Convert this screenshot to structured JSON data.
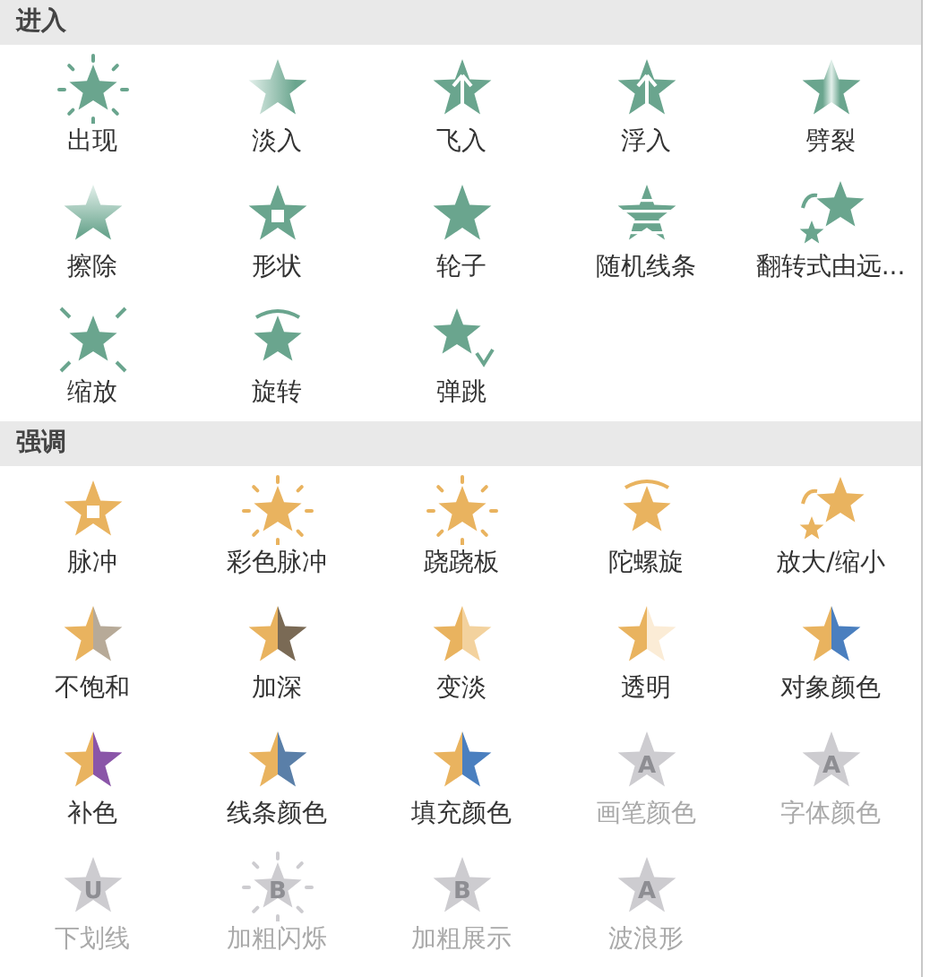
{
  "sections": [
    {
      "title": "进入",
      "kind": "entrance",
      "items": [
        {
          "label": "出现",
          "kind": "burst",
          "disabled": false
        },
        {
          "label": "淡入",
          "kind": "fadeleft",
          "disabled": false
        },
        {
          "label": "飞入",
          "kind": "arrow",
          "disabled": false
        },
        {
          "label": "浮入",
          "kind": "arrow",
          "disabled": false
        },
        {
          "label": "劈裂",
          "kind": "split",
          "disabled": false
        },
        {
          "label": "擦除",
          "kind": "fadetop",
          "disabled": false
        },
        {
          "label": "形状",
          "kind": "square",
          "disabled": false
        },
        {
          "label": "轮子",
          "kind": "plain",
          "disabled": false
        },
        {
          "label": "随机线条",
          "kind": "lines",
          "disabled": false
        },
        {
          "label": "翻转式由远...",
          "kind": "flip",
          "disabled": false
        },
        {
          "label": "缩放",
          "kind": "zoom",
          "disabled": false
        },
        {
          "label": "旋转",
          "kind": "spin",
          "disabled": false
        },
        {
          "label": "弹跳",
          "kind": "bounce",
          "disabled": false
        }
      ]
    },
    {
      "title": "强调",
      "kind": "emphasis",
      "items": [
        {
          "label": "脉冲",
          "kind": "glow",
          "disabled": false
        },
        {
          "label": "彩色脉冲",
          "kind": "burst",
          "disabled": false
        },
        {
          "label": "跷跷板",
          "kind": "burst",
          "disabled": false
        },
        {
          "label": "陀螺旋",
          "kind": "spin",
          "disabled": false
        },
        {
          "label": "放大/缩小",
          "kind": "flip",
          "disabled": false
        },
        {
          "label": "不饱和",
          "kind": "half",
          "color": "#b7aa98",
          "disabled": false
        },
        {
          "label": "加深",
          "kind": "half",
          "color": "#7a6a55",
          "disabled": false
        },
        {
          "label": "变淡",
          "kind": "half",
          "color": "#f3d29e",
          "disabled": false
        },
        {
          "label": "透明",
          "kind": "half",
          "color": "#fbecd6",
          "disabled": false
        },
        {
          "label": "对象颜色",
          "kind": "half",
          "color": "#4a7fbf",
          "disabled": false
        },
        {
          "label": "补色",
          "kind": "half",
          "color": "#8a55a8",
          "disabled": false
        },
        {
          "label": "线条颜色",
          "kind": "half",
          "color": "#5a7fa8",
          "disabled": false
        },
        {
          "label": "填充颜色",
          "kind": "half",
          "color": "#4a7fbf",
          "disabled": false
        },
        {
          "label": "画笔颜色",
          "kind": "letter",
          "glyph": "A",
          "disabled": true
        },
        {
          "label": "字体颜色",
          "kind": "letter",
          "glyph": "A",
          "disabled": true
        },
        {
          "label": "下划线",
          "kind": "letter",
          "glyph": "U",
          "disabled": true
        },
        {
          "label": "加粗闪烁",
          "kind": "burst",
          "glyph": "B",
          "disabled": true
        },
        {
          "label": "加粗展示",
          "kind": "letter",
          "glyph": "B",
          "disabled": true
        },
        {
          "label": "波浪形",
          "kind": "letter",
          "glyph": "A",
          "disabled": true
        }
      ]
    }
  ]
}
